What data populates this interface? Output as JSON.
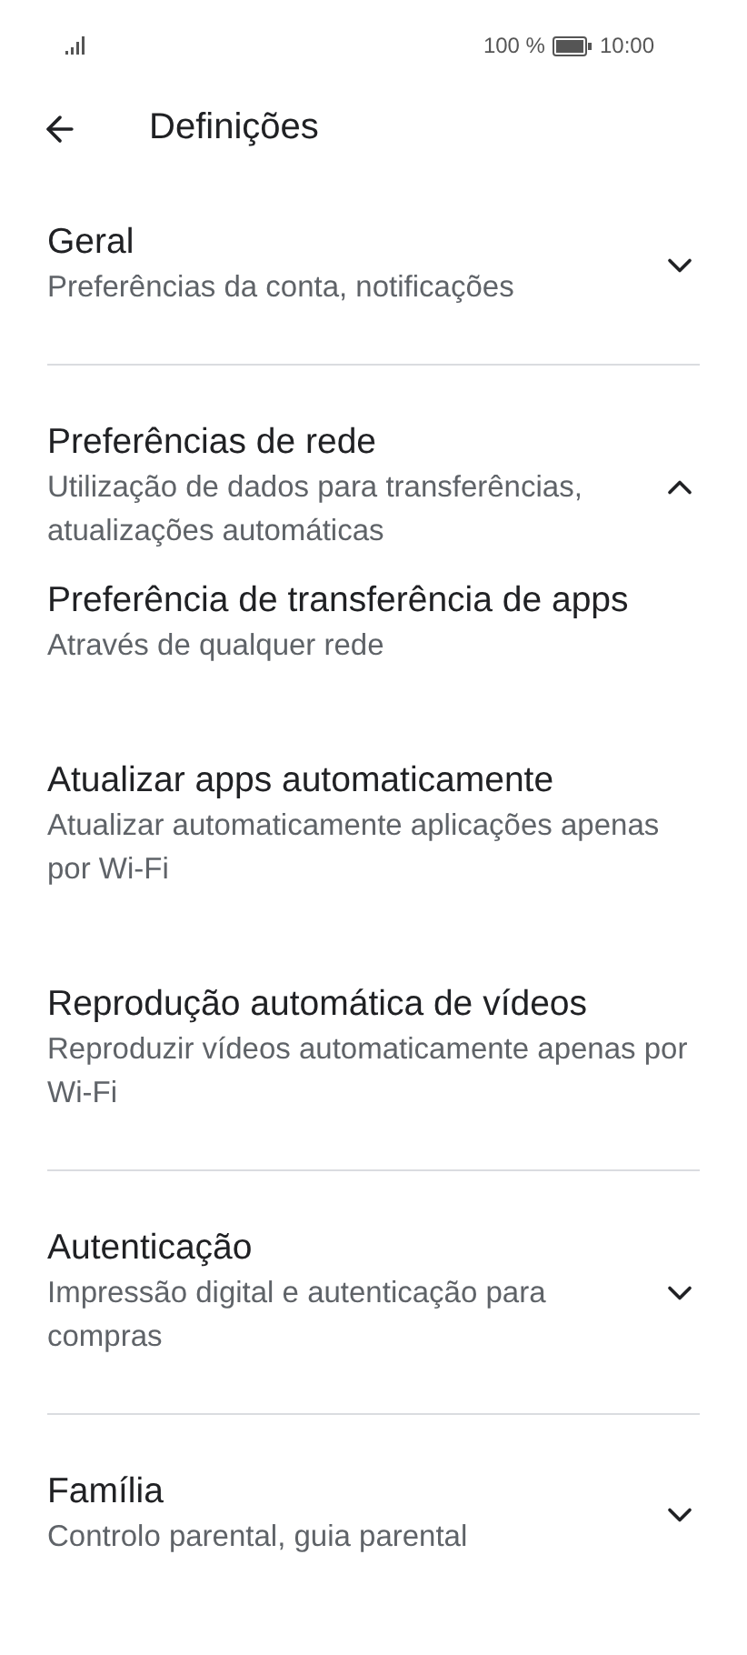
{
  "status_bar": {
    "battery": "100 %",
    "time": "10:00"
  },
  "header": {
    "title": "Definições"
  },
  "sections": [
    {
      "title": "Geral",
      "subtitle": "Preferências da conta, notificações",
      "expanded": false
    },
    {
      "title": "Preferências de rede",
      "subtitle": "Utilização de dados para transferências, atualizações automáticas",
      "expanded": true,
      "children": [
        {
          "title": "Preferência de transferência de apps",
          "subtitle": "Através de qualquer rede"
        },
        {
          "title": "Atualizar apps automaticamente",
          "subtitle": "Atualizar automaticamente aplicações apenas por Wi-Fi"
        },
        {
          "title": "Reprodução automática de vídeos",
          "subtitle": "Reproduzir vídeos automaticamente apenas por Wi-Fi"
        }
      ]
    },
    {
      "title": "Autenticação",
      "subtitle": "Impressão digital e autenticação para compras",
      "expanded": false
    },
    {
      "title": "Família",
      "subtitle": "Controlo parental, guia parental",
      "expanded": false
    }
  ]
}
